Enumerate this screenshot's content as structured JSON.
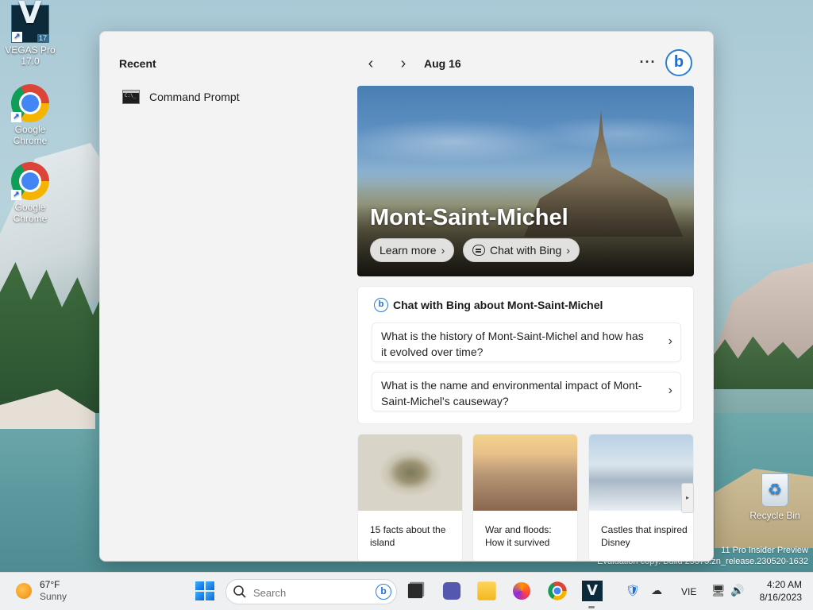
{
  "desktop": {
    "icons": [
      {
        "label_line1": "VEGAS Pro",
        "label_line2": "17.0",
        "icon": "vegas-pro-icon",
        "badge": "17"
      },
      {
        "label_line1": "Google",
        "label_line2": "Chrome",
        "icon": "chrome-icon"
      },
      {
        "label_line1": "Google",
        "label_line2": "Chrome",
        "icon": "chrome-icon"
      }
    ],
    "recycle_bin": {
      "label": "Recycle Bin",
      "icon": "recycle-bin-icon"
    },
    "watermark": {
      "line1": "11 Pro Insider Preview",
      "line2": "Evaluation copy. Build 25375.zn_release.230520-1632"
    }
  },
  "start_panel": {
    "recent": {
      "title": "Recent",
      "items": [
        {
          "label": "Command Prompt",
          "icon": "command-prompt-icon"
        }
      ]
    },
    "nav": {
      "prev_icon": "‹",
      "next_icon": "›",
      "date": "Aug 16",
      "more": "···",
      "bing_glyph": "b"
    },
    "hero": {
      "title": "Mont-Saint-Michel",
      "learn_more": "Learn more",
      "chat_with_bing": "Chat with Bing",
      "chevron": "›"
    },
    "chat_card": {
      "heading": "Chat with Bing about Mont-Saint-Michel",
      "questions": [
        "What is the history of Mont-Saint-Michel and how has it evolved over time?",
        "What is the name and environmental impact of Mont-Saint-Michel's causeway?"
      ],
      "chevron": "›"
    },
    "thumbnails": [
      {
        "caption": "15 facts about the island"
      },
      {
        "caption": "War and floods: How it survived"
      },
      {
        "caption": "Castles that inspired Disney"
      }
    ],
    "scroll_glyph": "▸"
  },
  "taskbar": {
    "weather": {
      "temp": "67°F",
      "condition": "Sunny"
    },
    "search": {
      "placeholder": "Search",
      "bing_glyph": "b"
    },
    "pinned": [
      "start-button",
      "task-view",
      "teams-chat",
      "file-explorer",
      "firefox",
      "chrome",
      "vegas-pro"
    ],
    "vegas_glyph": "V",
    "tray": {
      "language": "VIE",
      "shield": "🛡",
      "network_off": "☁",
      "display": "🖥",
      "volume": "🔊"
    },
    "clock": {
      "time": "4:20 AM",
      "date": "8/16/2023"
    }
  },
  "colors": {
    "accent": "#1d6ed6",
    "panel_bg": "#f3f3f3",
    "taskbar_bg": "#eef0f2"
  }
}
